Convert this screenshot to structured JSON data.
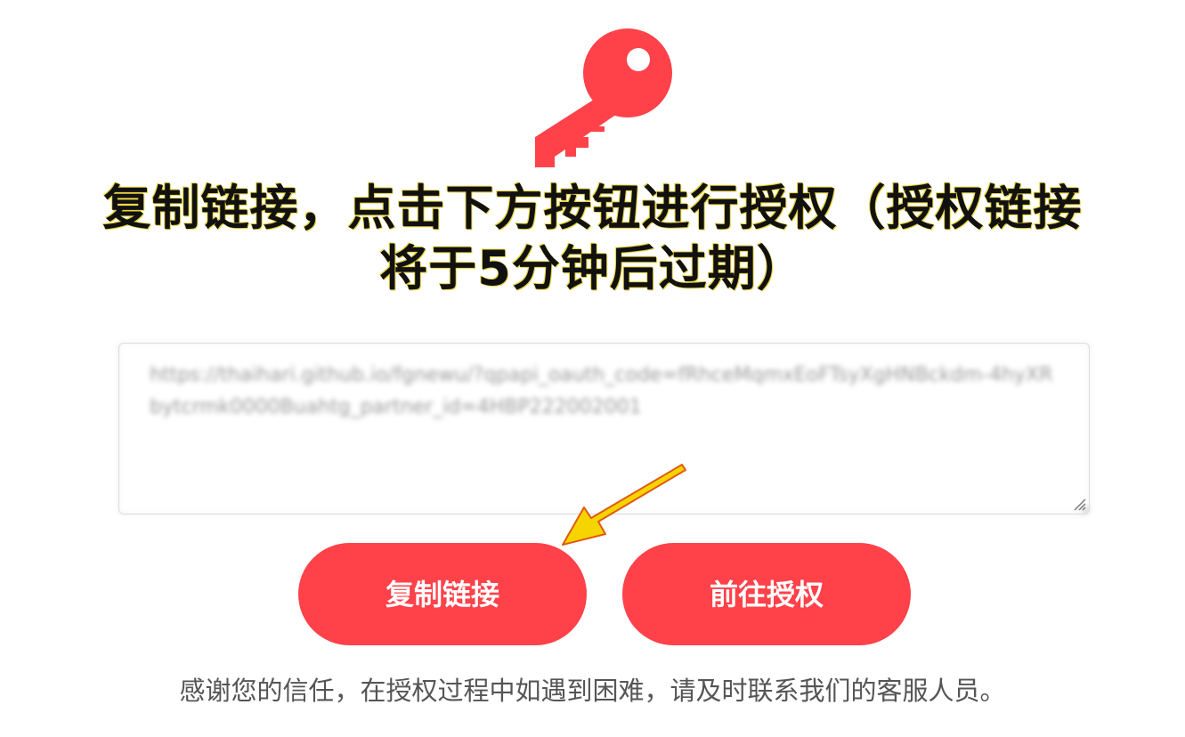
{
  "page": {
    "title": "复制链接，点击下方按钮进行授权（授权链接将于5分钟后过期）",
    "link_value": "https://thaihari.github.io/fgnewu/?qpapi_oauth_code=fRhceMqmxEoFTsyXgHNBckdm-4hyXRbytcrmk0000Buahtg_partner_id=4HBP222002001",
    "copy_button": "复制链接",
    "go_button": "前往授权",
    "footer": "感谢您的信任，在授权过程中如遇到困难，请及时联系我们的客服人员。"
  },
  "icons": {
    "hero": "key-icon",
    "pointer": "arrow-icon"
  },
  "colors": {
    "accent": "#ff4149",
    "title": "#111111",
    "footer": "#555555",
    "arrow": "#f5d400"
  }
}
